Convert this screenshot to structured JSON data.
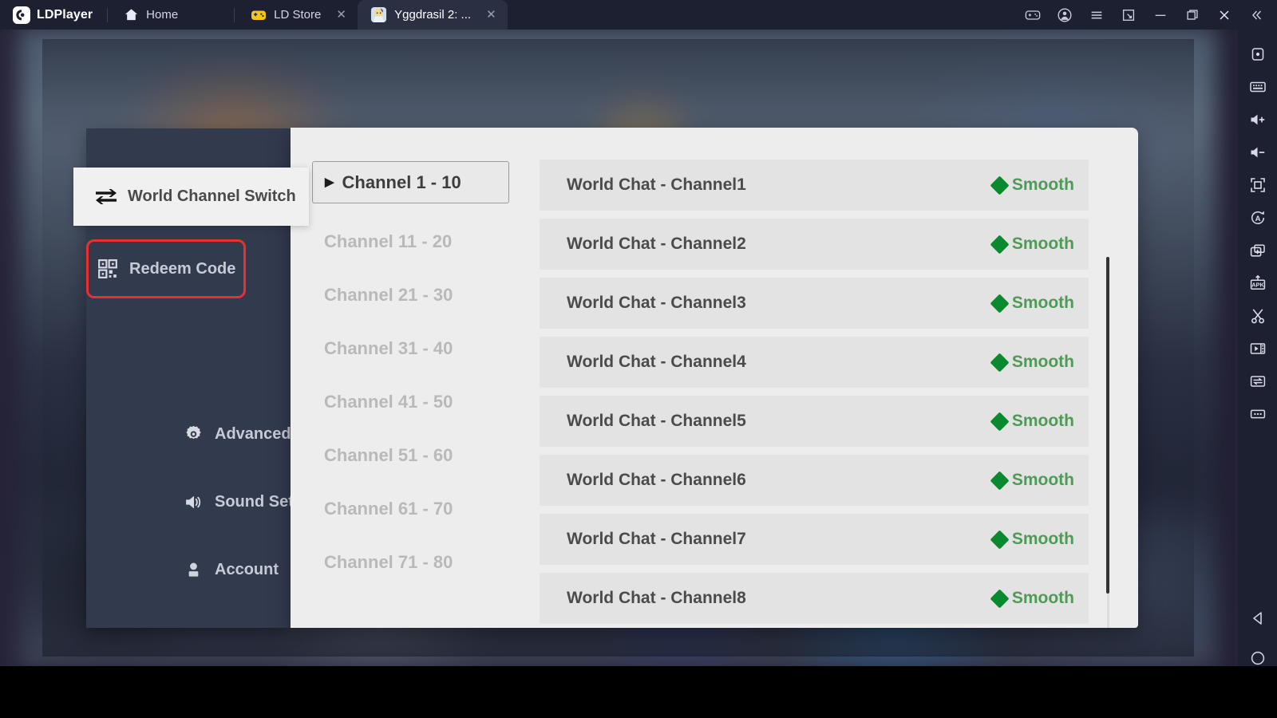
{
  "titlebar": {
    "brand": "LDPlayer",
    "brand_icon": "ldplayer-logo-icon",
    "tabs": [
      {
        "label": "Home",
        "icon": "home-icon",
        "closable": false,
        "active": false
      },
      {
        "label": "LD Store",
        "icon": "gamepad-yellow-icon",
        "closable": true,
        "close_label": "✕",
        "active": false
      },
      {
        "label": "Yggdrasil 2: ...",
        "icon": "game-avatar-icon",
        "closable": true,
        "close_label": "✕",
        "active": true
      }
    ],
    "window_buttons": [
      {
        "name": "gamepad-icon"
      },
      {
        "name": "account-icon"
      },
      {
        "name": "menu-icon"
      },
      {
        "name": "multi-instance-icon"
      },
      {
        "name": "minimize-icon"
      },
      {
        "name": "maximize-icon"
      },
      {
        "name": "close-icon"
      },
      {
        "name": "collapse-icon"
      }
    ]
  },
  "right_toolbar": {
    "buttons": [
      {
        "name": "operation-record-icon"
      },
      {
        "name": "keyboard-mapping-icon"
      },
      {
        "name": "volume-up-icon"
      },
      {
        "name": "volume-down-icon"
      },
      {
        "name": "fullscreen-icon"
      },
      {
        "name": "auto-rotate-icon"
      },
      {
        "name": "multi-instance-sync-icon"
      },
      {
        "name": "install-apk-icon"
      },
      {
        "name": "scissors-icon"
      },
      {
        "name": "video-record-icon"
      },
      {
        "name": "shake-icon"
      },
      {
        "name": "more-icon"
      }
    ],
    "nav_buttons": [
      {
        "name": "android-back-icon"
      },
      {
        "name": "android-home-icon"
      },
      {
        "name": "android-recents-icon"
      }
    ]
  },
  "sidebar": {
    "highlight_color": "#e8302f",
    "selected_item": {
      "label": "World Channel Switch",
      "icon": "switch-arrows-icon"
    },
    "items": [
      {
        "label": "Redeem Code",
        "icon": "qr-code-icon",
        "highlighted": true
      },
      {
        "label": "Advanced Settings",
        "icon": "gear-icon",
        "highlighted": false
      },
      {
        "label": "Sound Settings",
        "icon": "speaker-icon",
        "highlighted": false
      },
      {
        "label": "Account",
        "icon": "person-icon",
        "highlighted": false
      }
    ]
  },
  "dialog": {
    "groups": [
      {
        "label": "Channel 1 - 10",
        "selected": true,
        "caret": "▶"
      },
      {
        "label": "Channel 11 - 20",
        "selected": false
      },
      {
        "label": "Channel 21 - 30",
        "selected": false
      },
      {
        "label": "Channel 31 - 40",
        "selected": false
      },
      {
        "label": "Channel 41 - 50",
        "selected": false
      },
      {
        "label": "Channel 51 - 60",
        "selected": false
      },
      {
        "label": "Channel 61 - 70",
        "selected": false
      },
      {
        "label": "Channel 71 - 80",
        "selected": false
      }
    ],
    "status_color": "#098a2e",
    "channels": [
      {
        "name": "World Chat - Channel1",
        "status": "Smooth"
      },
      {
        "name": "World Chat - Channel2",
        "status": "Smooth"
      },
      {
        "name": "World Chat - Channel3",
        "status": "Smooth"
      },
      {
        "name": "World Chat - Channel4",
        "status": "Smooth"
      },
      {
        "name": "World Chat - Channel5",
        "status": "Smooth"
      },
      {
        "name": "World Chat - Channel6",
        "status": "Smooth"
      },
      {
        "name": "World Chat - Channel7",
        "status": "Smooth"
      },
      {
        "name": "World Chat - Channel8",
        "status": "Smooth"
      }
    ]
  }
}
